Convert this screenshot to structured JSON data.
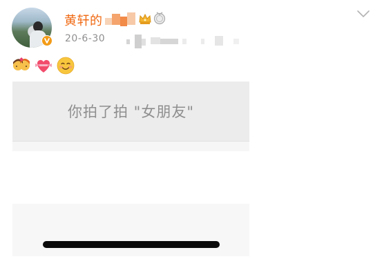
{
  "post": {
    "username": "黄轩的",
    "timestamp": "20-6-30",
    "quote": "你拍了拍 \"女朋友\""
  },
  "icons": {
    "verify": "verified-badge-icon",
    "crown": "crown-icon",
    "medal": "medal-icon",
    "more": "chevron-down-icon"
  },
  "emojis": [
    "kissing-couple-emoji",
    "heart-with-ribbon-emoji",
    "smiling-face-emoji"
  ],
  "colors": {
    "username": "#f06a14",
    "timestamp": "#8f8f8f",
    "quote_text": "#8e8e8e",
    "quote_bg": "#ececec",
    "verify_badge": "#f29b18"
  }
}
